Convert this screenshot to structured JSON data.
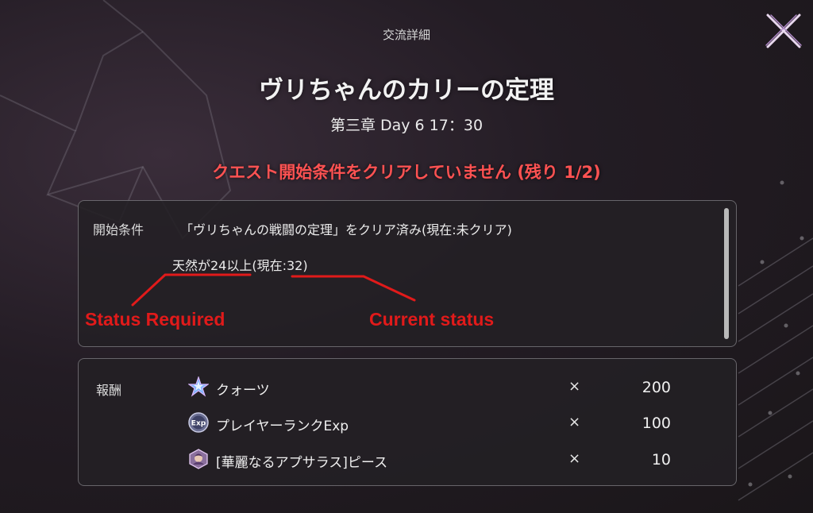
{
  "header": {
    "modal_title": "交流詳細",
    "close_icon": "close-icon"
  },
  "quest": {
    "title": "ヴリちゃんのカリーの定理",
    "time": "第三章 Day 6 17：30",
    "warning": "クエスト開始条件をクリアしていません (残り 1/2)"
  },
  "conditions": {
    "label": "開始条件",
    "line1": "「ヴリちゃんの戦闘の定理」をクリア済み(現在:未クリア)",
    "line2": "天然が24以上(現在:32)"
  },
  "rewards": {
    "label": "報酬",
    "items": [
      {
        "icon": "quartz-star-icon",
        "name": "クォーツ",
        "x": "×",
        "qty": "200"
      },
      {
        "icon": "exp-badge-icon",
        "name": "プレイヤーランクExp",
        "x": "×",
        "qty": "100"
      },
      {
        "icon": "character-piece-icon",
        "name": "[華麗なるアプサラス]ピース",
        "x": "×",
        "qty": "10"
      }
    ]
  },
  "annotations": {
    "status_required": "Status Required",
    "current_status": "Current status"
  },
  "colors": {
    "warning": "#ff5252",
    "annotation": "#e11a1a",
    "panel_border": "#a0a0a5"
  }
}
